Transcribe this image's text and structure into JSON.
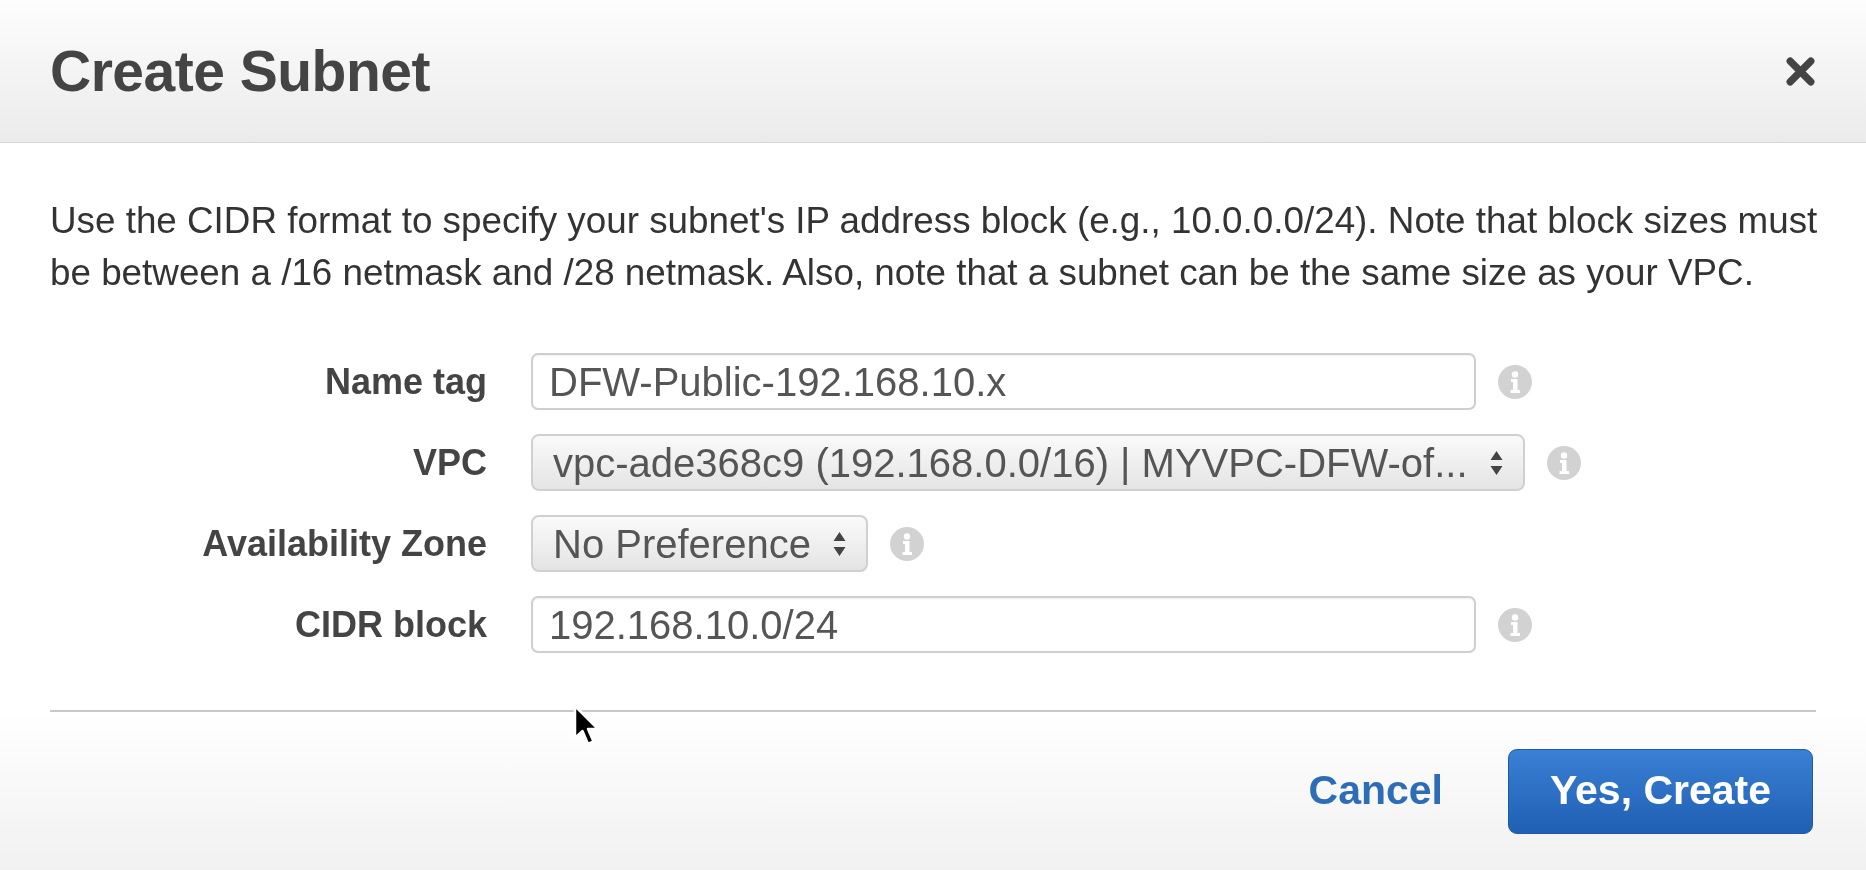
{
  "dialog": {
    "title": "Create Subnet"
  },
  "description": "Use the CIDR format to specify your subnet's IP address block (e.g., 10.0.0.0/24). Note that block sizes must be between a /16 netmask and /28 netmask. Also, note that a subnet can be the same size as your VPC.",
  "fields": [
    {
      "label": "Name tag",
      "kind": "text",
      "value": "DFW-Public-192.168.10.x"
    },
    {
      "label": "VPC",
      "kind": "select",
      "value": "vpc-ade368c9 (192.168.0.0/16) | MYVPC-DFW-of..."
    },
    {
      "label": "Availability Zone",
      "kind": "select",
      "value": "No Preference"
    },
    {
      "label": "CIDR block",
      "kind": "text",
      "value": "192.168.10.0/24"
    }
  ],
  "buttons": [
    {
      "label": "Cancel",
      "kind": "link"
    },
    {
      "label": "Yes, Create",
      "kind": "primary"
    }
  ]
}
